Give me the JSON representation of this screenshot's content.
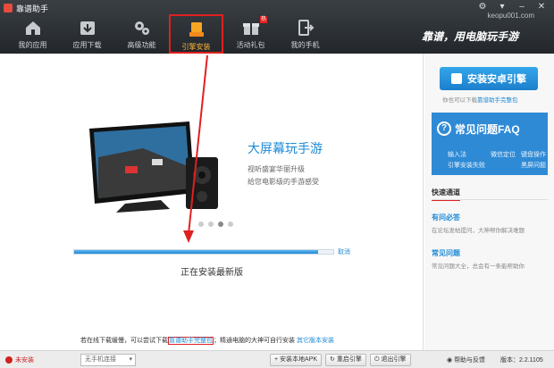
{
  "app": {
    "title": "靠谱助手",
    "site": "keopu001.com",
    "slogan": "靠谱，用电脑玩手游"
  },
  "nav": [
    {
      "label": "我的应用",
      "icon": "home-icon"
    },
    {
      "label": "应用下载",
      "icon": "download-icon"
    },
    {
      "label": "高级功能",
      "icon": "gears-icon"
    },
    {
      "label": "引擎安装",
      "icon": "engine-icon",
      "active": true
    },
    {
      "label": "活动礼包",
      "icon": "gift-icon",
      "badge": "热"
    },
    {
      "label": "我的手机",
      "icon": "phone-exit-icon"
    }
  ],
  "banner": {
    "title": "大屏幕玩手游",
    "sub1": "视听盛宴华丽升级",
    "sub2": "给您电影级的手游感受",
    "dots": 4,
    "active_dot": 2
  },
  "install": {
    "progress": 0.94,
    "cancel_label": "取消",
    "status": "正在安装最新版",
    "tip_pre": "若在线下载缓慢，可以尝试下载",
    "tip_link": "靠谱助手完整包",
    "tip_mid": "；精通电脑的大神可自行安装",
    "tip_link2": "其它版本安装"
  },
  "right": {
    "install_button": "安装安卓引擎",
    "hint_pre": "你也可以下载",
    "hint_link": "靠谱助手完整包",
    "faq_title": "常见问题FAQ",
    "faq_tags": [
      "输入法",
      "微信定位",
      "键盘操作",
      "引擎安装失败",
      "",
      "黑屏问题"
    ],
    "quick_title": "快速通道",
    "qa": [
      {
        "title": "有问必答",
        "desc": "在论坛发帖提问，大神帮你解决难题"
      },
      {
        "title": "常见问题",
        "desc": "常见问题大全，总会有一条能帮助你"
      }
    ]
  },
  "statusbar": {
    "uninstalled": "未安装",
    "connection": "无手机连接",
    "install_apk": "安装本地APK",
    "restart_engine": "重启引擎",
    "exit_engine": "退出引擎",
    "help": "帮助与反馈",
    "version_label": "版本：",
    "version": "2.2.1105"
  },
  "colors": {
    "accent": "#1e8ad6",
    "highlight": "#e02020",
    "topbar": "#2c3135"
  }
}
